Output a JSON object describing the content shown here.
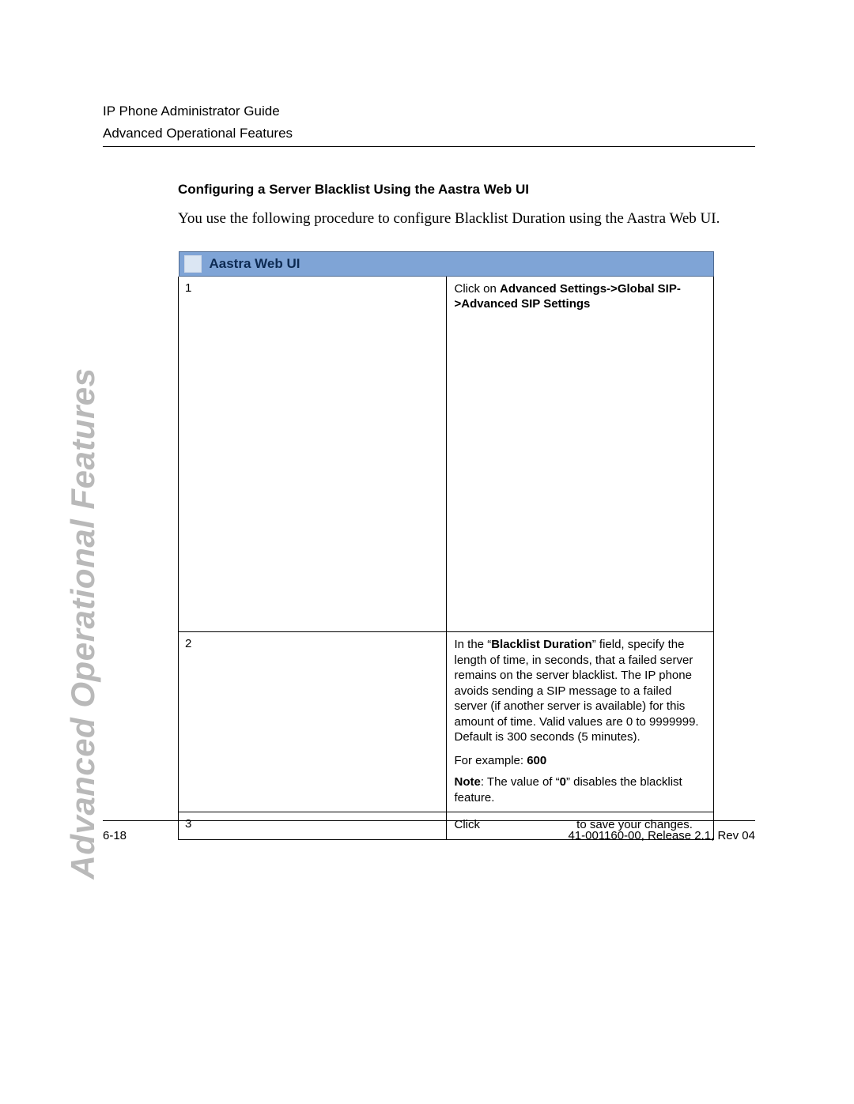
{
  "header": {
    "line1": "IP Phone Administrator Guide",
    "line2": "Advanced Operational Features"
  },
  "side_label": "Advanced Operational Features",
  "section_heading": "Configuring a Server Blacklist Using the Aastra Web UI",
  "intro_text": "You use the following procedure to configure Blacklist Duration using the Aastra Web UI.",
  "banner_title": "Aastra Web UI",
  "steps": [
    {
      "num": "1",
      "prefix": "Click on ",
      "bold": "Advanced Settings->Global SIP->Advanced SIP Settings"
    },
    {
      "num": "2",
      "prefix": "In the “",
      "bold_field": "Blacklist Duration",
      "after_field": "” field, specify the length of time, in seconds, that a failed server remains on the server blacklist. The IP phone avoids sending a SIP message to a failed server (if another server is available) for this amount of time. Valid values are 0 to 9999999. Default is 300 seconds (5 minutes).",
      "example_label": "For example: ",
      "example_value": "600",
      "note_label": "Note",
      "note_mid": ": The value of “",
      "note_bold": "0",
      "note_end": "” disables the blacklist feature."
    },
    {
      "num": "3",
      "prefix": "Click",
      "after_gap": " to save your changes."
    }
  ],
  "footer": {
    "left": "6-18",
    "right": "41-001160-00, Release 2.1, Rev 04"
  }
}
